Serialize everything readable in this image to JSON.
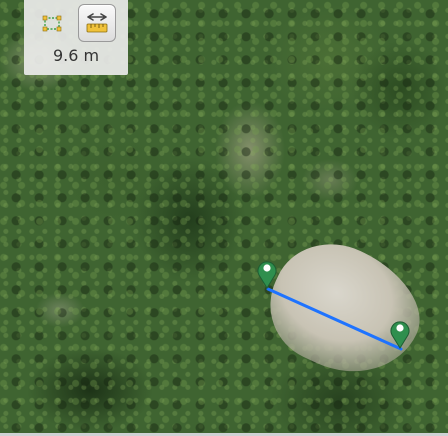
{
  "map": {
    "view": "satellite",
    "measure_line_color": "#1e73ff",
    "marker_color": "#2f8f4e"
  },
  "toolbar": {
    "area_tool_icon": "area-measure-icon",
    "distance_tool_icon": "distance-measure-icon",
    "distance_tool_active": true,
    "distance_readout": "9.6 m"
  }
}
